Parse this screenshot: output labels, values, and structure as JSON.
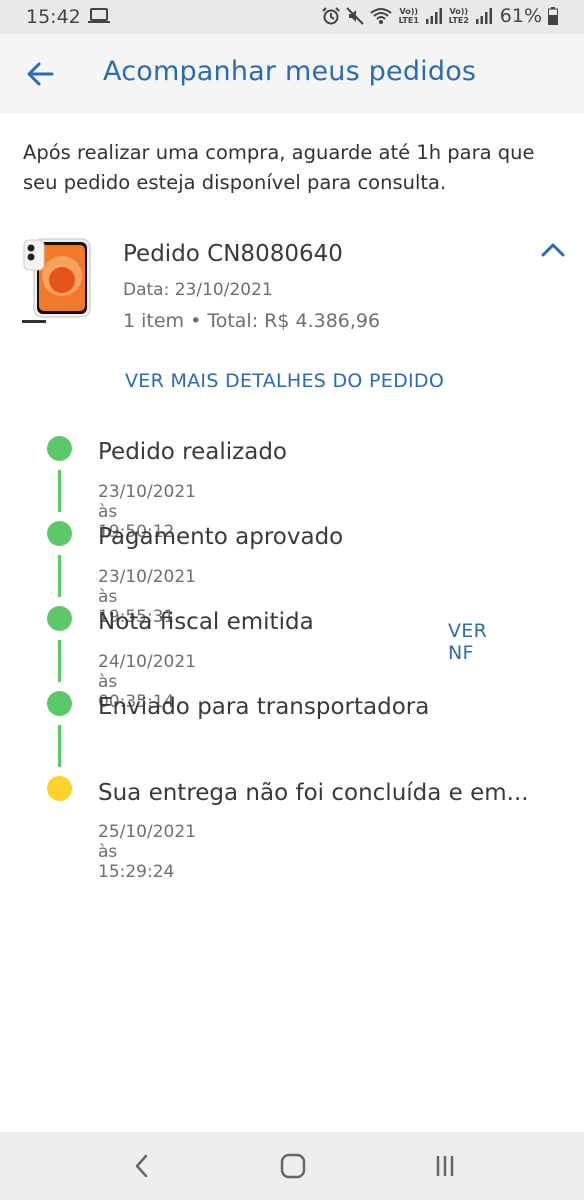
{
  "status_bar": {
    "time": "15:42",
    "lte1": "Vo)) LTE1",
    "lte2": "Vo)) LTE2",
    "battery": "61%"
  },
  "header": {
    "title": "Acompanhar meus pedidos",
    "back_icon": "arrow-left-icon"
  },
  "notice": "Após realizar uma compra, aguarde até 1h para que seu pedido esteja disponível para consulta.",
  "order": {
    "id_label": "Pedido CN8080640",
    "date_label": "Data: 23/10/2021",
    "summary": "1 item • Total: R$ 4.386,96",
    "details_link": "VER MAIS DETALHES DO PEDIDO",
    "toggle_icon": "chevron-up-icon"
  },
  "timeline": {
    "steps": [
      {
        "title": "Pedido realizado",
        "time": "23/10/2021 às 19:50:12",
        "status": "done"
      },
      {
        "title": "Pagamento aprovado",
        "time": "23/10/2021 às 19:55:31",
        "status": "done"
      },
      {
        "title": "Nota fiscal emitida",
        "time": "24/10/2021 às 00:35:14",
        "status": "done",
        "action": "VER NF"
      },
      {
        "title": "Enviado para transportadora",
        "time": "",
        "status": "done"
      },
      {
        "title": "Sua entrega não foi concluída e em...",
        "time": "25/10/2021 às 15:29:24",
        "status": "pending"
      }
    ]
  },
  "colors": {
    "accent": "#2b6cb0",
    "done": "#5cc86a",
    "pending": "#fdd22b"
  }
}
